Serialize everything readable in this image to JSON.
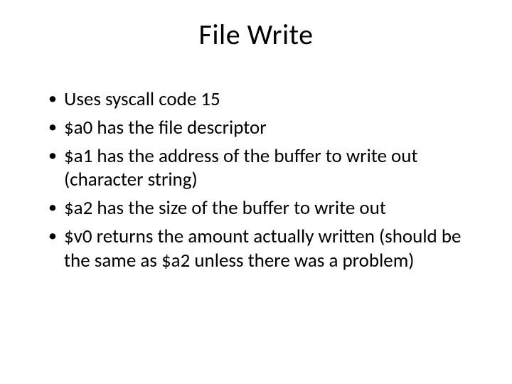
{
  "slide": {
    "title": "File Write",
    "bullets": [
      "Uses syscall code 15",
      "$a0 has the file descriptor",
      "$a1 has the address of the buffer to write out (character string)",
      "$a2 has the size of the buffer to write out",
      "$v0 returns the amount actually written (should be the same as $a2 unless there was a problem)"
    ]
  }
}
